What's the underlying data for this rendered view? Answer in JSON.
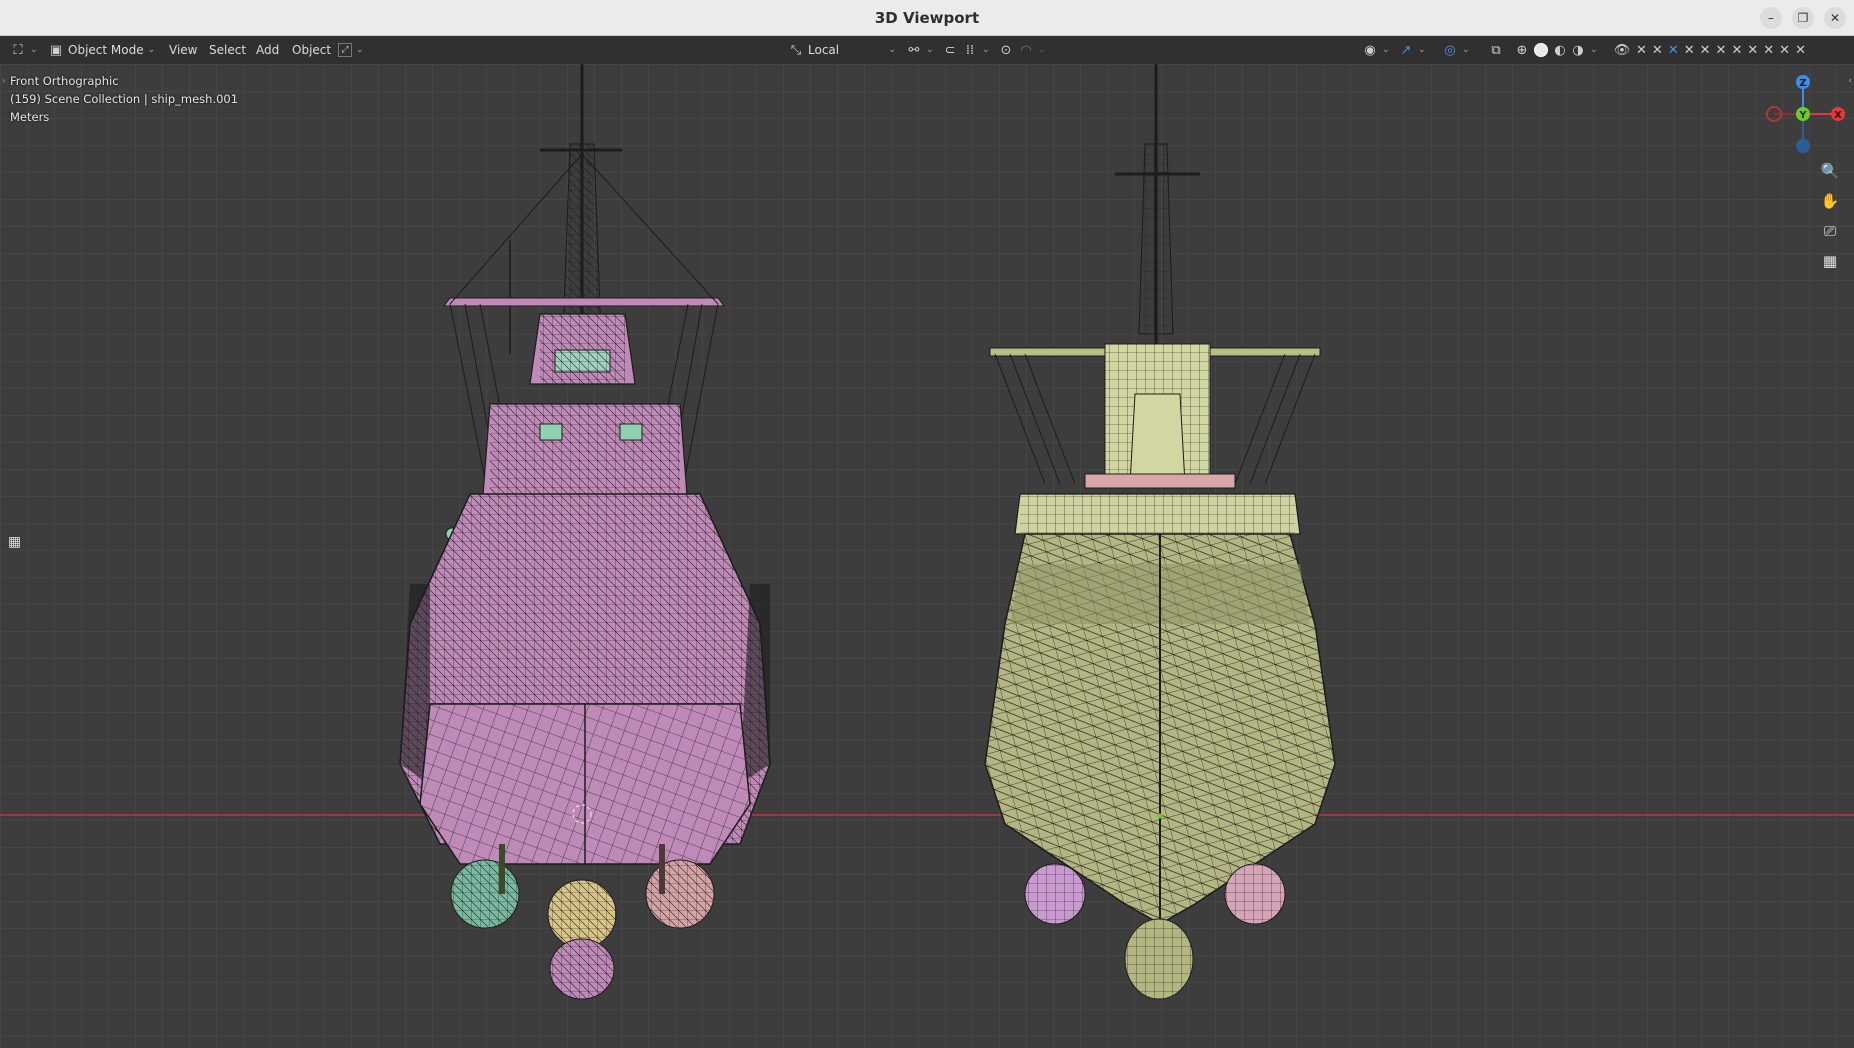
{
  "window": {
    "title": "3D Viewport",
    "controls": [
      "minimize",
      "maximize",
      "close"
    ]
  },
  "header": {
    "editor_type_icon": "editor-type-icon",
    "mode": "Object Mode",
    "menus": [
      "View",
      "Select",
      "Add",
      "Object"
    ],
    "transform_orientation": "Local",
    "shading_active": "solid"
  },
  "viewport": {
    "view_name": "Front Orthographic",
    "collection_info": "(159) Scene Collection | ship_mesh.001",
    "units": "Meters",
    "axis_colors": {
      "x": "#e03a3a",
      "y": "#6cc92e",
      "z": "#3d8ee8"
    },
    "gizmo_labels": {
      "x": "X",
      "y": "Y",
      "z": "Z"
    }
  },
  "objects": [
    {
      "name": "left-ship-pink-wireframe",
      "color": "#c08ab8"
    },
    {
      "name": "right-ship-olive-wireframe",
      "color": "#b8bf86"
    }
  ]
}
